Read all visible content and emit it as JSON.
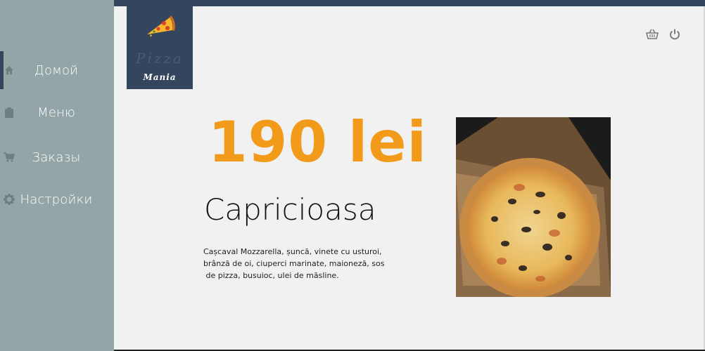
{
  "sidebar": {
    "items": [
      {
        "label": "Домой",
        "icon": "home-icon",
        "active": true
      },
      {
        "label": "Меню",
        "icon": "clipboard-icon",
        "active": false
      },
      {
        "label": "Заказы",
        "icon": "cart-icon",
        "active": false
      },
      {
        "label": "Настройки",
        "icon": "gear-icon",
        "active": false
      }
    ]
  },
  "logo": {
    "line1": "Pizza",
    "line2": "Mania",
    "icon": "pizza-slice-icon"
  },
  "header": {
    "icons": [
      "basket-icon",
      "power-icon"
    ]
  },
  "product": {
    "price": "190 lei",
    "name": "Capricioasa",
    "description": [
      "Cașcaval Mozzarella, șuncă, vinete cu usturoi,",
      "brânză de oi, ciuperci marinate, maioneză, sos",
      " de pizza, busuioc, ulei de măsline."
    ]
  },
  "colors": {
    "accent": "#f29a1a",
    "sidebar_bg": "#93a5a6",
    "navy": "#34465d",
    "page_bg": "#f1f1f1"
  }
}
